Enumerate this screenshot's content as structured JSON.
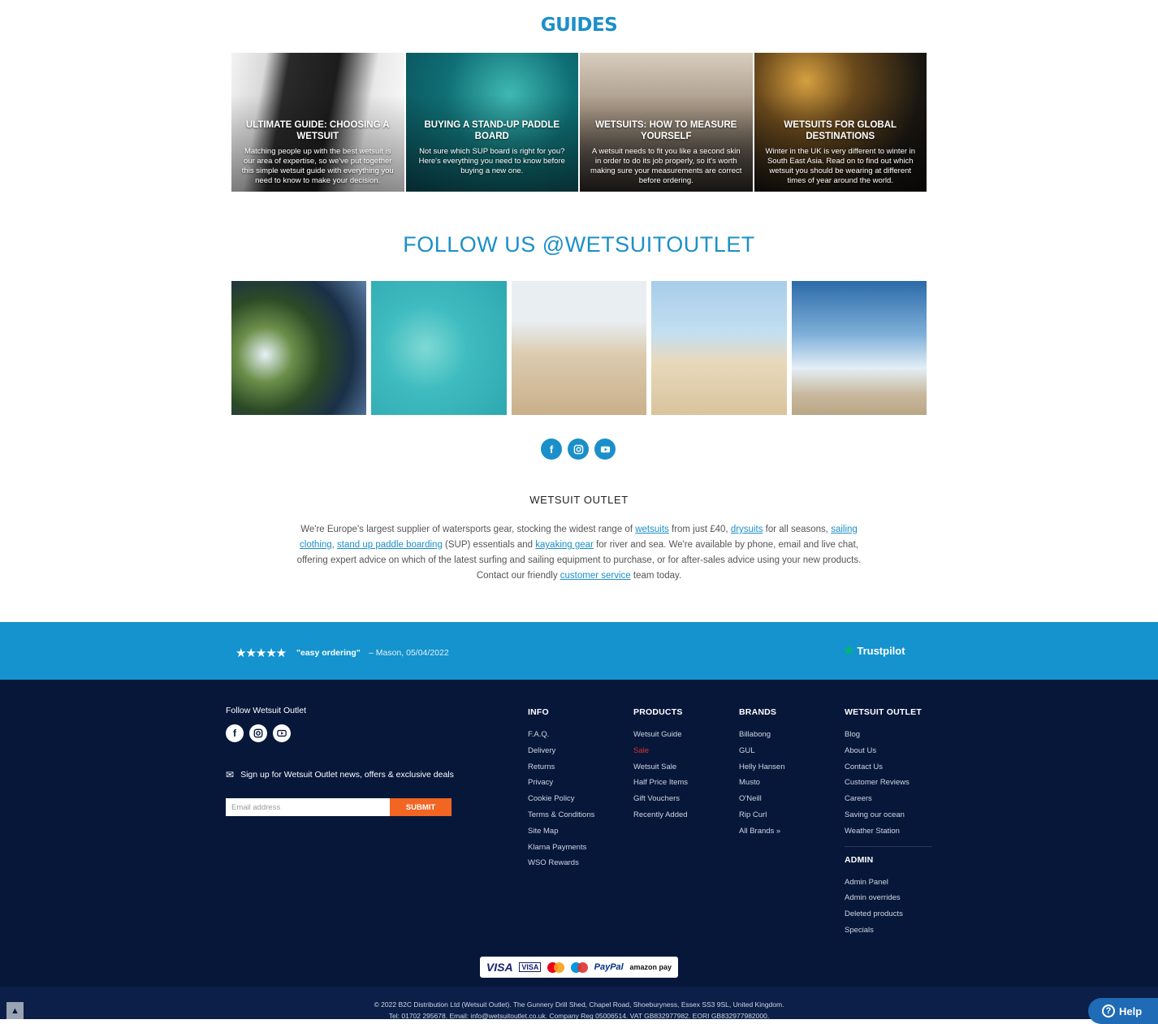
{
  "guides": {
    "title": "GUIDES",
    "items": [
      {
        "title": "ULTIMATE GUIDE: CHOOSING A WETSUIT",
        "desc": "Matching people up with the best wetsuit is our area of expertise, so we've put together this simple wetsuit guide with everything you need to know to make your decision."
      },
      {
        "title": "BUYING A STAND-UP PADDLE BOARD",
        "desc": "Not sure which SUP board is right for you? Here's everything you need to know before buying a new one."
      },
      {
        "title": "WETSUITS: HOW TO MEASURE YOURSELF",
        "desc": "A wetsuit needs to fit you like a second skin in order to do its job properly, so it's worth making sure your measurements are correct before ordering."
      },
      {
        "title": "WETSUITS FOR GLOBAL DESTINATIONS",
        "desc": "Winter in the UK is very different to winter in South East Asia. Read on to find out which wetsuit you should be wearing at different times of year around the world."
      }
    ]
  },
  "follow": {
    "title": "FOLLOW US @WETSUITOUTLET",
    "social_icons": [
      "facebook-icon",
      "instagram-icon",
      "youtube-icon"
    ]
  },
  "about": {
    "heading": "WETSUIT OUTLET",
    "t1": "We're Europe's largest supplier of watersports gear, stocking the widest range of ",
    "l1": "wetsuits",
    "t2": " from just £40, ",
    "l2": "drysuits",
    "t3": " for all seasons, ",
    "l3": "sailing clothing",
    "t4": ", ",
    "l4": "stand up paddle boarding",
    "t5": " (SUP) essentials and ",
    "l5": "kayaking gear",
    "t6": " for river and sea. We're available by phone, email and live chat, offering expert advice on which of the latest surfing and sailing equipment to purchase, or for after-sales advice using your new products. Contact our friendly ",
    "l6": "customer service",
    "t7": " team today."
  },
  "review": {
    "stars": "★★★★★",
    "rating": 5,
    "quote": "\"easy ordering\"",
    "reviewer": "– Mason, 05/04/2022",
    "trustpilot": "Trustpilot",
    "colors": {
      "bar": "#1493ce",
      "trustpilot_star": "#00b67a"
    }
  },
  "footer": {
    "follow_label": "Follow Wetsuit Outlet",
    "signup_text": "Sign up for Wetsuit Outlet news, offers & exclusive deals",
    "email_placeholder": "Email address",
    "submit_label": "SUBMIT",
    "columns": {
      "info": {
        "title": "INFO",
        "items": [
          "F.A.Q.",
          "Delivery",
          "Returns",
          "Privacy",
          "Cookie Policy",
          "Terms & Conditions",
          "Site Map",
          "Klarna Payments",
          "WSO Rewards"
        ]
      },
      "products": {
        "title": "PRODUCTS",
        "items": [
          "Wetsuit Guide",
          "Sale",
          "Wetsuit Sale",
          "Half Price Items",
          "Gift Vouchers",
          "Recently Added"
        ]
      },
      "brands": {
        "title": "BRANDS",
        "items": [
          "Billabong",
          "GUL",
          "Helly Hansen",
          "Musto",
          "O'Neill",
          "Rip Curl",
          "All Brands »"
        ]
      },
      "wetsuit_outlet": {
        "title": "WETSUIT OUTLET",
        "items": [
          "Blog",
          "About Us",
          "Contact Us",
          "Customer Reviews",
          "Careers",
          "Saving our ocean",
          "Weather Station"
        ]
      },
      "admin": {
        "title": "ADMIN",
        "items": [
          "Admin Panel",
          "Admin overrides",
          "Deleted products",
          "Specials"
        ]
      }
    },
    "colors": {
      "background": "#06173a",
      "submit": "#f26522",
      "sale": "#e0322d"
    }
  },
  "payments": {
    "visa": "VISA",
    "visa_electron": "VISA",
    "paypal": "PayPal",
    "amazon": "amazon pay"
  },
  "bottom": {
    "line1": "© 2022 B2C Distribution Ltd (Wetsuit Outlet). The Gunnery Drill Shed, Chapel Road, Shoeburyness, Essex SS3 9SL, United Kingdom.",
    "line2": "Tel: 01702 295678. Email: info@wetsuitoutlet.co.uk. Company Reg 05006514. VAT GB832977982. EORI GB832977982000.",
    "help_label": "Help"
  },
  "colors": {
    "accent": "#1b8fc9"
  }
}
